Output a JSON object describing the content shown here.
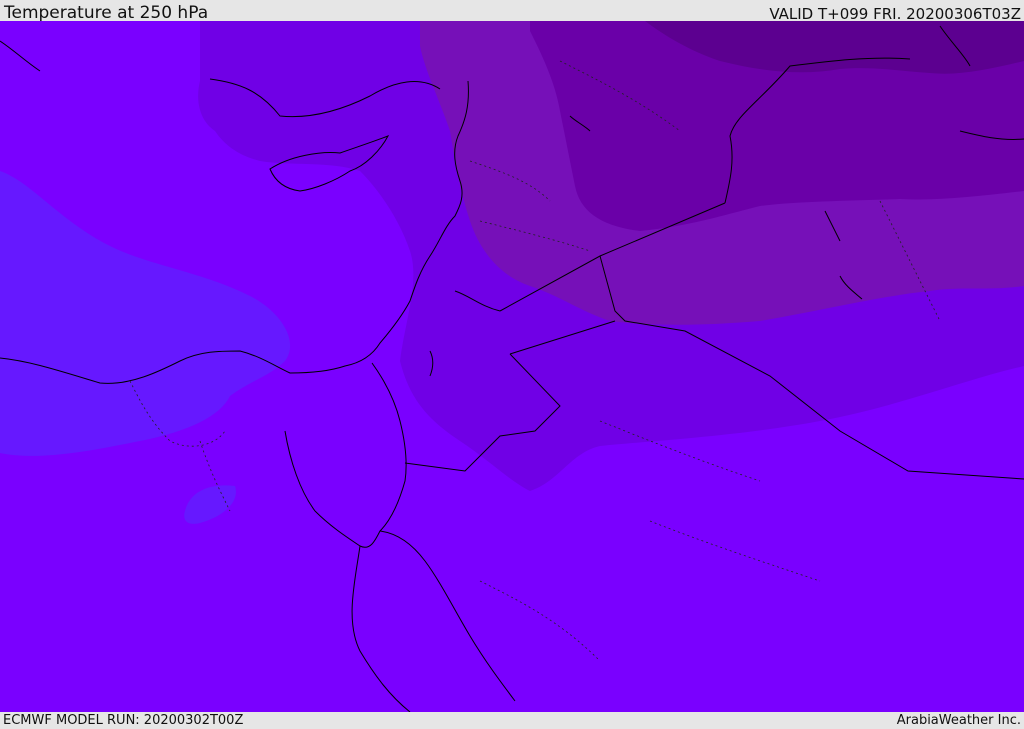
{
  "header": {
    "title": "Temperature at 250 hPa",
    "valid_time": "VALID T+099 FRI. 20200306T03Z"
  },
  "footer": {
    "model_run": "ECMWF MODEL RUN: 20200302T00Z",
    "credit": "ArabiaWeather Inc."
  },
  "colors": {
    "base": "#7a00ff",
    "cool": "#6618ff",
    "warm1": "#7000e6",
    "warm2": "#7610b8",
    "warm3": "#6a00a8",
    "warm4": "#5c0090",
    "coast": "#000000"
  }
}
